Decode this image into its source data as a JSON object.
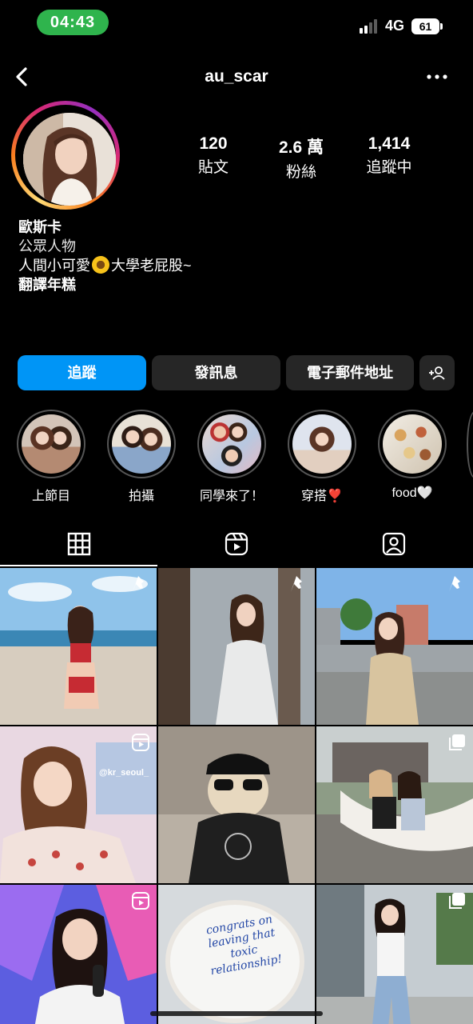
{
  "status_bar": {
    "time": "04:43",
    "network": "4G",
    "battery": "61"
  },
  "header": {
    "username": "au_scar"
  },
  "stats": [
    {
      "value": "120",
      "label": "貼文"
    },
    {
      "value": "2.6 萬",
      "label": "粉絲"
    },
    {
      "value": "1,414",
      "label": "追蹤中"
    }
  ],
  "bio": {
    "name": "歐斯卡",
    "category": "公眾人物",
    "line_before_emoji": "人間小可愛",
    "line_after_emoji": "大學老屁股~",
    "translate": "翻譯年糕"
  },
  "buttons": {
    "follow": "追蹤",
    "message": "發訊息",
    "email": "電子郵件地址"
  },
  "highlights": [
    {
      "label": "上節目"
    },
    {
      "label": "拍攝"
    },
    {
      "label": "同學來了！"
    },
    {
      "label": "穿搭❣️"
    },
    {
      "label": "food🤍"
    }
  ],
  "posts": [
    {
      "badge": "pin",
      "theme": "beach"
    },
    {
      "badge": "pin",
      "theme": "forest"
    },
    {
      "badge": "pin",
      "theme": "street"
    },
    {
      "badge": "reel",
      "theme": "tv-studio",
      "overlay": "@kr_seoul_"
    },
    {
      "badge": "none",
      "theme": "dog"
    },
    {
      "badge": "carousel",
      "theme": "hammock"
    },
    {
      "badge": "reel",
      "theme": "tv-show"
    },
    {
      "badge": "none",
      "theme": "cake",
      "cake_text": "congrats on leaving that toxic relationship!"
    },
    {
      "badge": "carousel",
      "theme": "city-street"
    }
  ]
}
